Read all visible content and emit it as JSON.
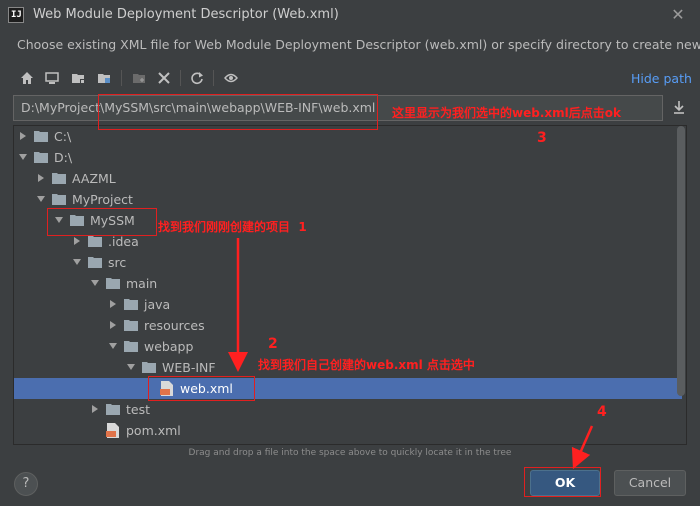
{
  "window": {
    "app_icon_text": "IJ",
    "title": "Web Module Deployment Descriptor (Web.xml)",
    "close_label": "✕"
  },
  "description": "Choose existing XML file for Web Module Deployment Descriptor (web.xml) or specify directory to create new file.",
  "toolbar": {
    "icons": [
      "home-icon",
      "desktop-icon",
      "project-icon",
      "module-icon",
      "new-folder-icon",
      "delete-icon",
      "refresh-icon",
      "show-hidden-icon"
    ],
    "hide_path_label": "Hide path"
  },
  "path": {
    "value": "D:\\MyProject\\MySSM\\src\\main\\webapp\\WEB-INF\\web.xml"
  },
  "tree": {
    "rows": [
      {
        "label": "C:\\",
        "expanded": false
      },
      {
        "label": "D:\\",
        "expanded": true
      },
      {
        "label": "AAZML",
        "expanded": false
      },
      {
        "label": "MyProject",
        "expanded": true
      },
      {
        "label": "MySSM",
        "expanded": true
      },
      {
        "label": ".idea",
        "expanded": false
      },
      {
        "label": "src",
        "expanded": true
      },
      {
        "label": "main",
        "expanded": true
      },
      {
        "label": "java",
        "expanded": false
      },
      {
        "label": "resources",
        "expanded": false
      },
      {
        "label": "webapp",
        "expanded": true
      },
      {
        "label": "WEB-INF",
        "expanded": true
      },
      {
        "label": "web.xml",
        "selected": true
      },
      {
        "label": "test",
        "expanded": false
      },
      {
        "label": "pom.xml"
      }
    ]
  },
  "hint": "Drag and drop a file into the space above to quickly locate it in the tree",
  "buttons": {
    "help": "?",
    "ok": "OK",
    "cancel": "Cancel"
  },
  "annotations": {
    "path_note": "这里显示为我们选中的web.xml后点击ok",
    "path_num": "3",
    "project_note": "找到我们刚刚创建的项目",
    "project_num": "1",
    "file_note": "找到我们自己创建的web.xml 点击选中",
    "file_num": "2",
    "ok_num": "4"
  },
  "colors": {
    "background": "#3c3f41",
    "selection": "#4b6eaf",
    "link": "#589df6",
    "ok_button": "#365880",
    "annotation": "#ff2020"
  }
}
